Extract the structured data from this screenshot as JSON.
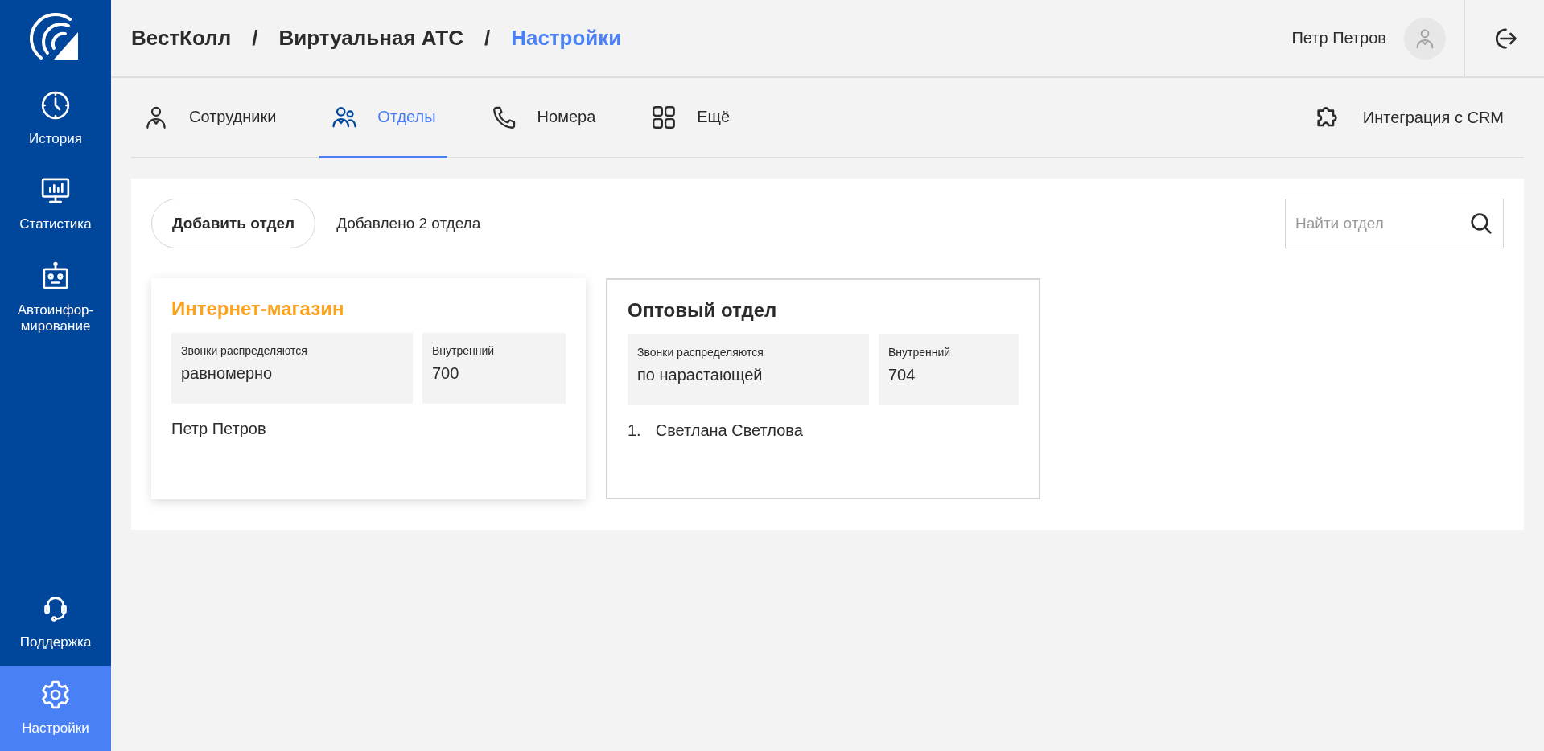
{
  "sidebar": {
    "items": [
      {
        "label": "История",
        "selected": false
      },
      {
        "label": "Статистика",
        "selected": false
      },
      {
        "label": "Автоинфор-\nмирование",
        "selected": false
      }
    ],
    "bottom_items": [
      {
        "label": "Поддержка",
        "selected": false
      },
      {
        "label": "Настройки",
        "selected": true
      }
    ]
  },
  "breadcrumbs": [
    {
      "label": "ВестКолл",
      "current": false
    },
    {
      "label": "Виртуальная АТС",
      "current": false
    },
    {
      "label": "Настройки",
      "current": true
    }
  ],
  "breadcrumb_separator": "/",
  "user": {
    "name": "Петр Петров"
  },
  "tabs": [
    {
      "label": "Сотрудники",
      "selected": false
    },
    {
      "label": "Отделы",
      "selected": true
    },
    {
      "label": "Номера",
      "selected": false
    },
    {
      "label": "Ещё",
      "selected": false
    }
  ],
  "integration_link": "Интеграция с CRM",
  "toolbar": {
    "add_button": "Добавить отдел",
    "count_text": "Добавлено 2 отдела",
    "search": {
      "placeholder": "Найти отдел"
    }
  },
  "departments": [
    {
      "name": "Интернет-магазин",
      "hovered": true,
      "distribution_label": "Звонки распределяются",
      "distribution": "равномерно",
      "extension_label": "Внутренний",
      "extension": "700",
      "members": [
        {
          "name": "Петр Петров"
        }
      ]
    },
    {
      "name": "Оптовый отдел",
      "hovered": false,
      "distribution_label": "Звонки распределяются",
      "distribution": "по нарастающей",
      "extension_label": "Внутренний",
      "extension": "704",
      "members": [
        {
          "number": "1.",
          "name": "Светлана Светлова"
        }
      ]
    }
  ]
}
